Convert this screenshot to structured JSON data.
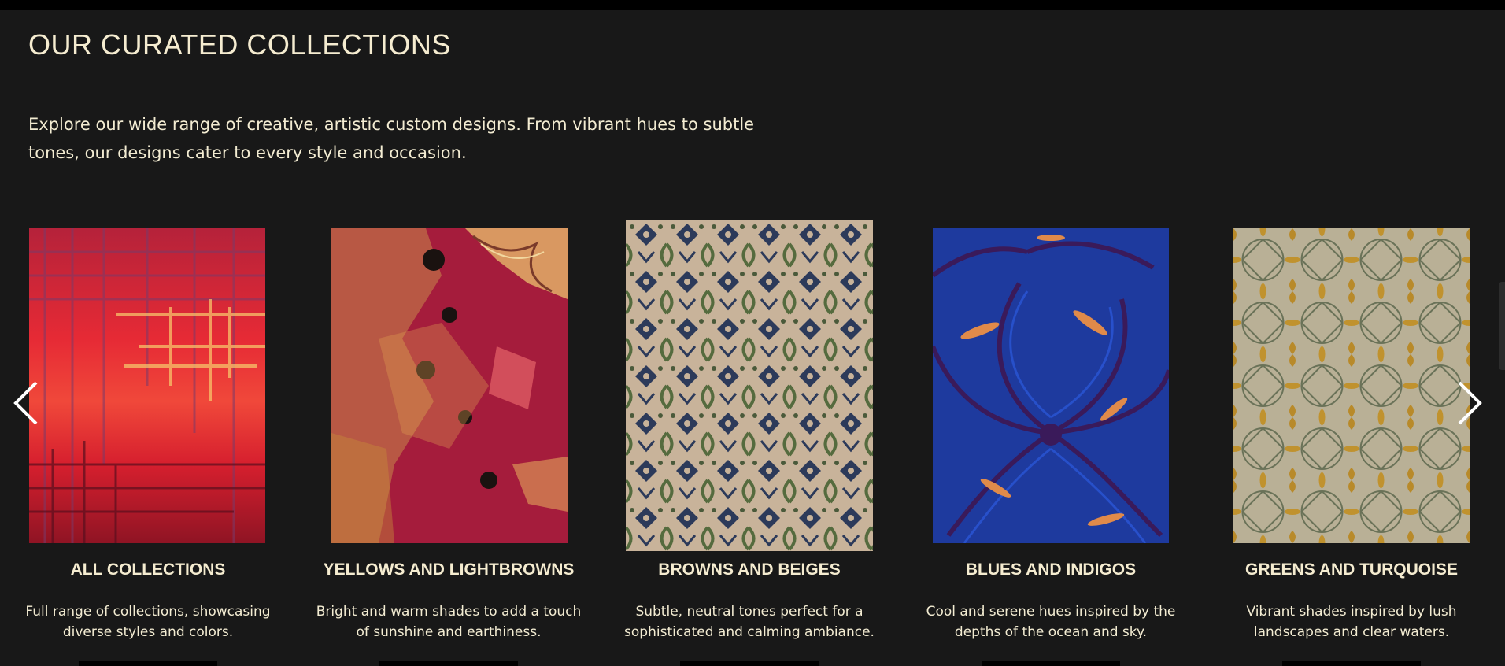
{
  "section": {
    "heading": "OUR CURATED COLLECTIONS",
    "intro_line1": "Explore our wide range of creative, artistic custom designs. From vibrant hues to subtle",
    "intro_line2": "tones, our designs cater to every style and occasion."
  },
  "carousel": {
    "prev_icon": "chevron-left-icon",
    "next_icon": "chevron-right-icon",
    "cards": [
      {
        "title": "ALL COLLECTIONS",
        "desc_line1": "Full range of collections, showcasing",
        "desc_line2": "diverse styles and colors.",
        "image": "red-plaid-rug"
      },
      {
        "title": "YELLOWS AND LIGHTBROWNS",
        "desc_line1": "Bright and warm shades to add a touch",
        "desc_line2": "of sunshine and earthiness.",
        "image": "crimson-gold-abstract-rug"
      },
      {
        "title": "BROWNS AND BEIGES",
        "desc_line1": "Subtle, neutral tones perfect for a",
        "desc_line2": "sophisticated and calming ambiance.",
        "image": "beige-navy-damask-rug"
      },
      {
        "title": "BLUES AND INDIGOS",
        "desc_line1": "Cool and serene hues inspired by the",
        "desc_line2": "depths of the ocean and sky.",
        "image": "blue-swirl-rug"
      },
      {
        "title": "GREENS AND TURQUOISE",
        "desc_line1": "Vibrant shades inspired by lush",
        "desc_line2": "landscapes and clear waters.",
        "image": "sage-gold-lattice-rug"
      }
    ]
  },
  "colors": {
    "background": "#181818",
    "text": "#f3ecd2",
    "accent_black": "#000000"
  }
}
